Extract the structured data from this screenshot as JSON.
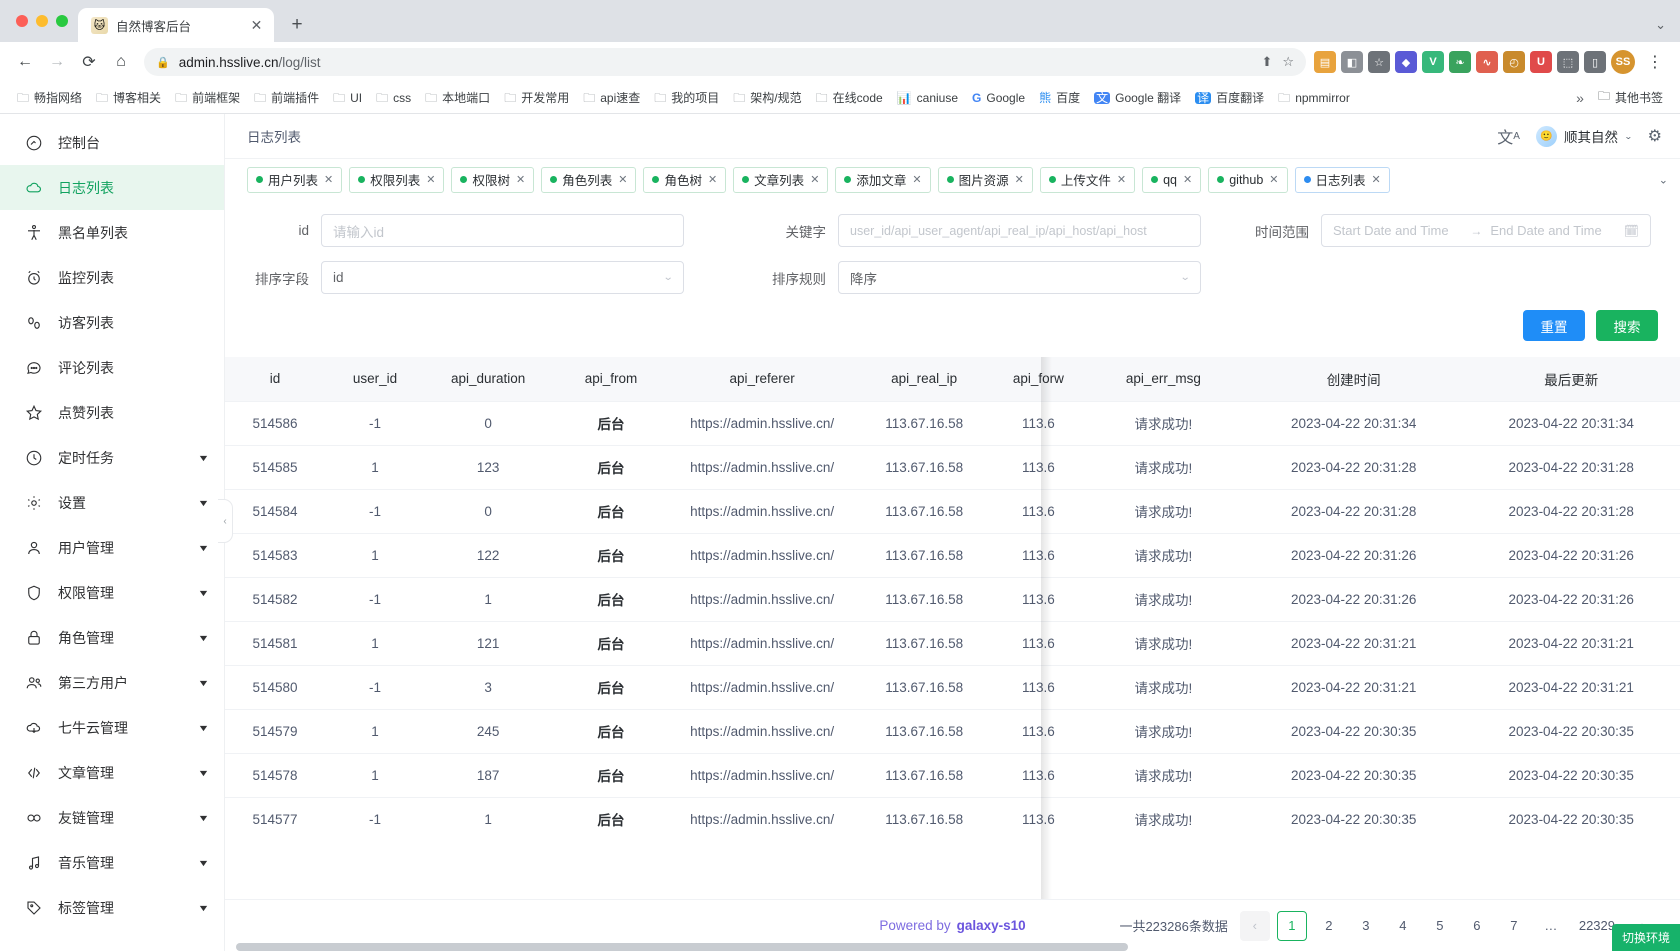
{
  "browser": {
    "tab": {
      "title": "自然博客后台",
      "favicon": "blog-favicon",
      "close": "✕"
    },
    "newtab_label": "+",
    "tabstrip_right": "⌄",
    "nav": {
      "back": "←",
      "forward": "→",
      "reload": "⟳",
      "home": "⌂"
    },
    "omnibox": {
      "lock": "🔒",
      "host": "admin.hsslive.cn",
      "path": "/log/list",
      "share": "⬆",
      "star": "☆"
    },
    "extensions": [
      "reader-ext",
      "pin-ext",
      "star-ext",
      "gem-ext",
      "v-ext",
      "leaf-ext",
      "chart-ext",
      "clock-ext",
      "u-ext",
      "puzzle-ext",
      "sidepanel-ext"
    ],
    "profile_initials": "SS",
    "menu": "⋮",
    "bookmarks": [
      {
        "label": "畅指网络",
        "icon": "folder-icon"
      },
      {
        "label": "博客相关",
        "icon": "folder-icon"
      },
      {
        "label": "前端框架",
        "icon": "folder-icon"
      },
      {
        "label": "前端插件",
        "icon": "folder-icon"
      },
      {
        "label": "UI",
        "icon": "folder-icon"
      },
      {
        "label": "css",
        "icon": "folder-icon"
      },
      {
        "label": "本地端口",
        "icon": "folder-icon"
      },
      {
        "label": "开发常用",
        "icon": "folder-icon"
      },
      {
        "label": "api速查",
        "icon": "folder-icon"
      },
      {
        "label": "我的项目",
        "icon": "folder-icon"
      },
      {
        "label": "架构/规范",
        "icon": "folder-icon"
      },
      {
        "label": "在线code",
        "icon": "folder-icon"
      },
      {
        "label": "caniuse",
        "icon": "caniuse-icon"
      },
      {
        "label": "Google",
        "icon": "google-icon"
      },
      {
        "label": "百度",
        "icon": "baidu-icon"
      },
      {
        "label": "Google 翻译",
        "icon": "gtranslate-icon"
      },
      {
        "label": "百度翻译",
        "icon": "baidu-translate-icon"
      },
      {
        "label": "npmmirror",
        "icon": "folder-icon"
      }
    ],
    "bookmarks_overflow": "»",
    "other_bookmarks": "其他书签"
  },
  "sidebar": {
    "items": [
      {
        "label": "控制台",
        "icon": "dashboard-icon",
        "active": false,
        "expandable": false
      },
      {
        "label": "日志列表",
        "icon": "cloud-icon",
        "active": true,
        "expandable": false
      },
      {
        "label": "黑名单列表",
        "icon": "person-icon",
        "active": false,
        "expandable": false
      },
      {
        "label": "监控列表",
        "icon": "alarm-icon",
        "active": false,
        "expandable": false
      },
      {
        "label": "访客列表",
        "icon": "footprints-icon",
        "active": false,
        "expandable": false
      },
      {
        "label": "评论列表",
        "icon": "comment-icon",
        "active": false,
        "expandable": false
      },
      {
        "label": "点赞列表",
        "icon": "star-icon",
        "active": false,
        "expandable": false
      },
      {
        "label": "定时任务",
        "icon": "clock-icon",
        "active": false,
        "expandable": true
      },
      {
        "label": "设置",
        "icon": "gear-icon",
        "active": false,
        "expandable": true
      },
      {
        "label": "用户管理",
        "icon": "user-icon",
        "active": false,
        "expandable": true
      },
      {
        "label": "权限管理",
        "icon": "shield-icon",
        "active": false,
        "expandable": true
      },
      {
        "label": "角色管理",
        "icon": "lock-icon",
        "active": false,
        "expandable": true
      },
      {
        "label": "第三方用户",
        "icon": "users-icon",
        "active": false,
        "expandable": true
      },
      {
        "label": "七牛云管理",
        "icon": "cloud-download-icon",
        "active": false,
        "expandable": true
      },
      {
        "label": "文章管理",
        "icon": "code-icon",
        "active": false,
        "expandable": true
      },
      {
        "label": "友链管理",
        "icon": "link-infinity-icon",
        "active": false,
        "expandable": true
      },
      {
        "label": "音乐管理",
        "icon": "music-icon",
        "active": false,
        "expandable": true
      },
      {
        "label": "标签管理",
        "icon": "tag-icon",
        "active": false,
        "expandable": true
      }
    ],
    "collapse_handle": "‹"
  },
  "topbar": {
    "breadcrumb": "日志列表",
    "language_icon": "translate-icon",
    "user_name": "顺其自然",
    "user_caret": "⌄",
    "settings_icon": "gear-icon"
  },
  "tagtabs": {
    "items": [
      {
        "label": "用户列表",
        "current": false
      },
      {
        "label": "权限列表",
        "current": false
      },
      {
        "label": "权限树",
        "current": false
      },
      {
        "label": "角色列表",
        "current": false
      },
      {
        "label": "角色树",
        "current": false
      },
      {
        "label": "文章列表",
        "current": false
      },
      {
        "label": "添加文章",
        "current": false
      },
      {
        "label": "图片资源",
        "current": false
      },
      {
        "label": "上传文件",
        "current": false
      },
      {
        "label": "qq",
        "current": false
      },
      {
        "label": "github",
        "current": false
      },
      {
        "label": "日志列表",
        "current": true
      }
    ],
    "close_glyph": "✕",
    "expand_glyph": "⌄"
  },
  "search_form": {
    "id_label": "id",
    "id_placeholder": "请输入id",
    "id_value": "",
    "keyword_label": "关键字",
    "keyword_placeholder": "user_id/api_user_agent/api_real_ip/api_host/api_host",
    "keyword_value": "",
    "daterange_label": "时间范围",
    "date_start_placeholder": "Start Date and Time",
    "date_end_placeholder": "End Date and Time",
    "date_arrow": "→",
    "calendar_icon": "calendar-icon",
    "sortfield_label": "排序字段",
    "sortfield_value": "id",
    "sortrule_label": "排序规则",
    "sortrule_value": "降序",
    "reset_label": "重置",
    "search_label": "搜索"
  },
  "table": {
    "columns": [
      "id",
      "user_id",
      "api_duration",
      "api_from",
      "api_referer",
      "api_real_ip",
      "api_forw",
      "api_err_msg",
      "创建时间",
      "最后更新"
    ],
    "rows": [
      [
        "514586",
        "-1",
        "0",
        "后台",
        "https://admin.hsslive.cn/",
        "113.67.16.58",
        "113.6",
        "请求成功!",
        "2023-04-22 20:31:34",
        "2023-04-22 20:31:34"
      ],
      [
        "514585",
        "1",
        "123",
        "后台",
        "https://admin.hsslive.cn/",
        "113.67.16.58",
        "113.6",
        "请求成功!",
        "2023-04-22 20:31:28",
        "2023-04-22 20:31:28"
      ],
      [
        "514584",
        "-1",
        "0",
        "后台",
        "https://admin.hsslive.cn/",
        "113.67.16.58",
        "113.6",
        "请求成功!",
        "2023-04-22 20:31:28",
        "2023-04-22 20:31:28"
      ],
      [
        "514583",
        "1",
        "122",
        "后台",
        "https://admin.hsslive.cn/",
        "113.67.16.58",
        "113.6",
        "请求成功!",
        "2023-04-22 20:31:26",
        "2023-04-22 20:31:26"
      ],
      [
        "514582",
        "-1",
        "1",
        "后台",
        "https://admin.hsslive.cn/",
        "113.67.16.58",
        "113.6",
        "请求成功!",
        "2023-04-22 20:31:26",
        "2023-04-22 20:31:26"
      ],
      [
        "514581",
        "1",
        "121",
        "后台",
        "https://admin.hsslive.cn/",
        "113.67.16.58",
        "113.6",
        "请求成功!",
        "2023-04-22 20:31:21",
        "2023-04-22 20:31:21"
      ],
      [
        "514580",
        "-1",
        "3",
        "后台",
        "https://admin.hsslive.cn/",
        "113.67.16.58",
        "113.6",
        "请求成功!",
        "2023-04-22 20:31:21",
        "2023-04-22 20:31:21"
      ],
      [
        "514579",
        "1",
        "245",
        "后台",
        "https://admin.hsslive.cn/",
        "113.67.16.58",
        "113.6",
        "请求成功!",
        "2023-04-22 20:30:35",
        "2023-04-22 20:30:35"
      ],
      [
        "514578",
        "1",
        "187",
        "后台",
        "https://admin.hsslive.cn/",
        "113.67.16.58",
        "113.6",
        "请求成功!",
        "2023-04-22 20:30:35",
        "2023-04-22 20:30:35"
      ],
      [
        "514577",
        "-1",
        "1",
        "后台",
        "https://admin.hsslive.cn/",
        "113.67.16.58",
        "113.6",
        "请求成功!",
        "2023-04-22 20:30:35",
        "2023-04-22 20:30:35"
      ]
    ]
  },
  "footer": {
    "powered_prefix": "Powered by",
    "powered_name": "galaxy-s10",
    "total_text": "一共223286条数据",
    "prev_glyph": "‹",
    "pages": [
      "1",
      "2",
      "3",
      "4",
      "5",
      "6",
      "7"
    ],
    "current_page": "1",
    "ellipsis": "…",
    "last_page": "22329",
    "next_glyph": "›"
  },
  "env_badge": "切换环境",
  "colors": {
    "accent_green": "#19b35f",
    "accent_blue": "#1f8df7",
    "sidebar_active_bg": "#e8f6ee",
    "purple": "#6b55de"
  }
}
